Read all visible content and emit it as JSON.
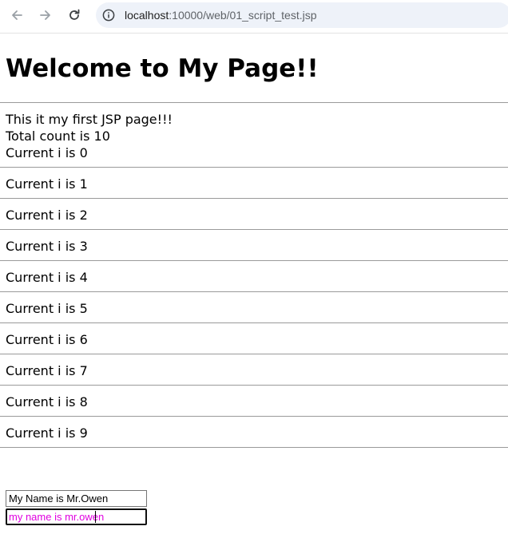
{
  "browser": {
    "url_host": "localhost",
    "url_path": ":10000/web/01_script_test.jsp"
  },
  "page": {
    "heading": "Welcome to My Page!!",
    "intro": "This it my first JSP page!!!",
    "total": "Total count is 10",
    "loop_items": [
      "Current i is 0",
      "Current i is 1",
      "Current i is 2",
      "Current i is 3",
      "Current i is 4",
      "Current i is 5",
      "Current i is 6",
      "Current i is 7",
      "Current i is 8",
      "Current i is 9"
    ],
    "input_1_value": "My Name is Mr.Owen",
    "input_2_value": "my name is mr.owen"
  },
  "colors": {
    "input_2_text": "#e000e0",
    "hr": "#9a9a9a"
  }
}
